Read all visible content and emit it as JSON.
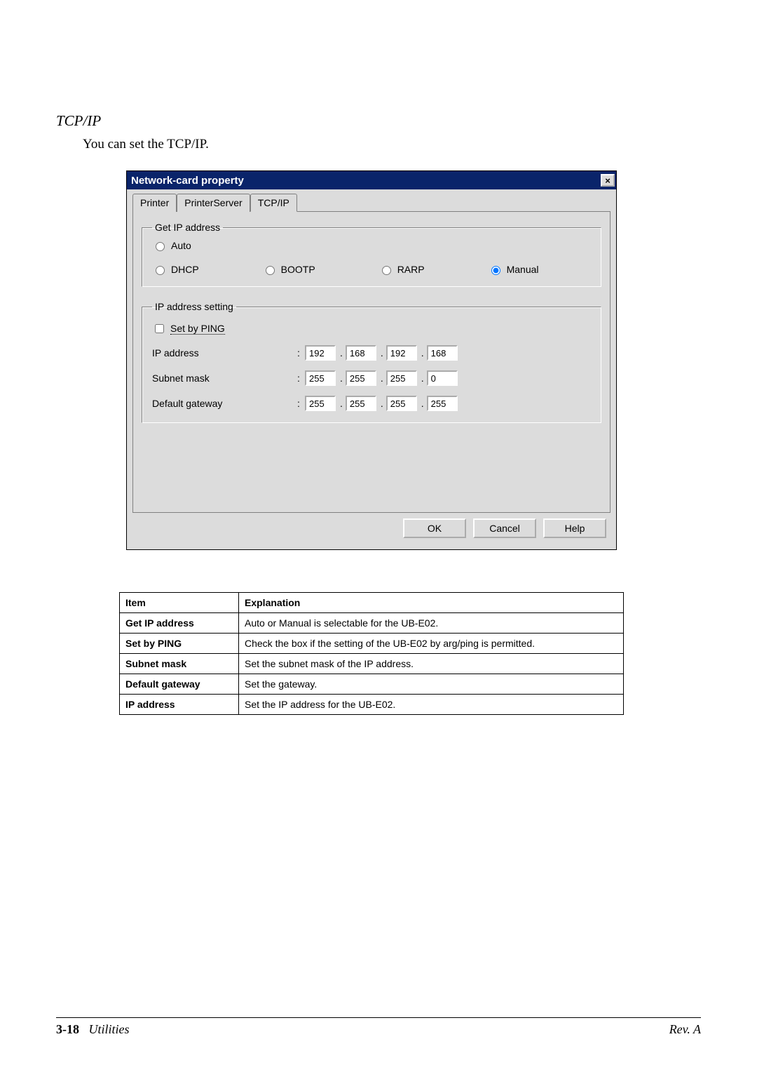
{
  "heading": "TCP/IP",
  "intro": "You can set the TCP/IP.",
  "dialog": {
    "title": "Network-card property",
    "close": "×",
    "tabs": [
      "Printer",
      "PrinterServer",
      "TCP/IP"
    ],
    "active_tab": 2,
    "group1_legend": "Get IP address",
    "radio_auto": "Auto",
    "radio_dhcp": "DHCP",
    "radio_bootp": "BOOTP",
    "radio_rarp": "RARP",
    "radio_manual": "Manual",
    "group2_legend": "IP address setting",
    "set_by_ping": "Set by PING",
    "ip_label": "IP address",
    "subnet_label": "Subnet mask",
    "gateway_label": "Default gateway",
    "ip_value": [
      "192",
      "168",
      "192",
      "168"
    ],
    "subnet_value": [
      "255",
      "255",
      "255",
      "0"
    ],
    "gw_value": [
      "255",
      "255",
      "255",
      "255"
    ],
    "btn_ok": "OK",
    "btn_cancel": "Cancel",
    "btn_help": "Help"
  },
  "table": {
    "header_item": "Item",
    "header_explanation": "Explanation",
    "rows": [
      {
        "item": "Get IP address",
        "explanation": "Auto or Manual is selectable for the UB-E02."
      },
      {
        "item": "Set by PING",
        "explanation": "Check the box if the setting of the UB-E02 by arg/ping is permitted."
      },
      {
        "item": "Subnet mask",
        "explanation": "Set the subnet mask of the IP address."
      },
      {
        "item": "Default gateway",
        "explanation": "Set the gateway."
      },
      {
        "item": "IP address",
        "explanation": "Set the IP address for the UB-E02."
      }
    ]
  },
  "footer": {
    "page": "3-18",
    "section": "Utilities",
    "rev": "Rev. A"
  }
}
